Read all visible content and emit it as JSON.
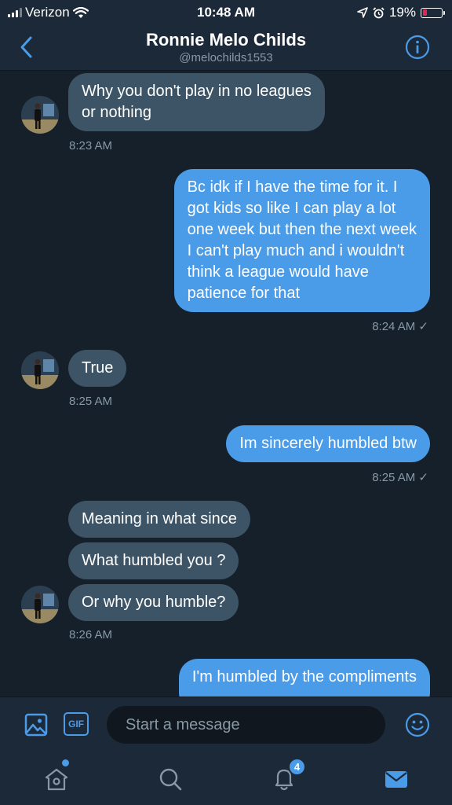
{
  "status_bar": {
    "carrier": "Verizon",
    "time": "10:48 AM",
    "battery": "19%"
  },
  "header": {
    "name": "Ronnie Melo Childs",
    "handle": "@melochilds1553"
  },
  "messages": [
    {
      "text_lines": [
        "Why you don't play in no leagues",
        "or nothing"
      ]
    },
    {
      "time": "8:23 AM"
    },
    {
      "text_lines": [
        "Bc idk if I have the time for it. I",
        "got kids so like I can play a lot",
        "one week but then the next week",
        "I can't play much and i wouldn't",
        "think a league would have",
        "patience for that"
      ]
    },
    {
      "time": "8:24 AM",
      "status": "✓"
    },
    {
      "text": "True"
    },
    {
      "time": "8:25 AM"
    },
    {
      "text": "Im sincerely humbled btw"
    },
    {
      "time": "8:25 AM",
      "status": "✓"
    },
    {
      "text": "Meaning in what since"
    },
    {
      "text": "What humbled you ?"
    },
    {
      "text": "Or why you humble?"
    },
    {
      "time": "8:26 AM"
    },
    {
      "text": "I'm humbled by the compliments"
    }
  ],
  "composer": {
    "placeholder": "Start a message",
    "gif_label": "GIF"
  },
  "tabbar": {
    "notifications_badge": "4"
  },
  "colors": {
    "background": "#15202b",
    "bar": "#1c2938",
    "incoming_bubble": "#3d5466",
    "outgoing_bubble": "#4a9be8",
    "accent": "#4a9be8",
    "muted": "#8899a6"
  },
  "icons": [
    "back-chevron-icon",
    "info-icon",
    "image-icon",
    "emoji-icon",
    "home-icon",
    "search-icon",
    "bell-icon",
    "mail-icon",
    "location-arrow-icon",
    "alarm-icon",
    "wifi-icon"
  ]
}
